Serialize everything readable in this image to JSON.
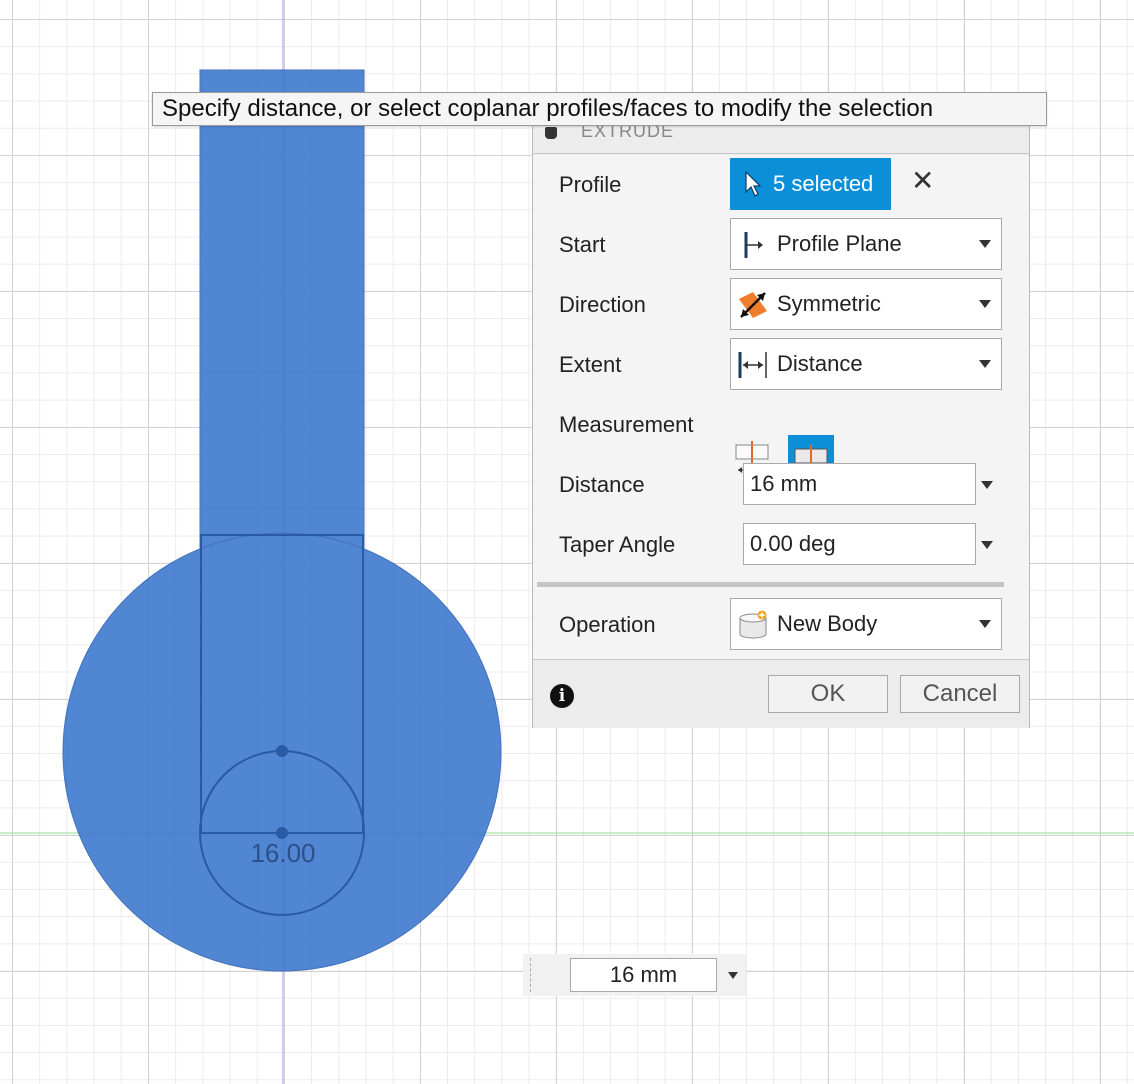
{
  "tooltip": {
    "text": "Specify distance, or select coplanar profiles/faces to modify the selection"
  },
  "dialog": {
    "title": "EXTRUDE",
    "profile": {
      "label": "Profile",
      "value": "5 selected"
    },
    "start": {
      "label": "Start",
      "value": "Profile Plane",
      "icon": "profile-plane-icon"
    },
    "direction": {
      "label": "Direction",
      "value": "Symmetric",
      "icon": "symmetric-icon"
    },
    "extent": {
      "label": "Extent",
      "value": "Distance",
      "icon": "distance-icon"
    },
    "measurement": {
      "label": "Measurement",
      "options": [
        "half-length-icon",
        "whole-length-icon"
      ],
      "selected": 1
    },
    "distance": {
      "label": "Distance",
      "value": "16 mm"
    },
    "taper": {
      "label": "Taper Angle",
      "value": "0.00 deg"
    },
    "operation": {
      "label": "Operation",
      "value": "New Body",
      "icon": "new-body-icon"
    },
    "ok_label": "OK",
    "cancel_label": "Cancel"
  },
  "viewport": {
    "dimension_label": "16.00",
    "body_color": "#3f79cf"
  },
  "mini_input": {
    "value": "16 mm"
  },
  "colors": {
    "accent": "#0b8fd8",
    "x_axis": "#7fd67f",
    "y_axis": "#8f8fff"
  }
}
